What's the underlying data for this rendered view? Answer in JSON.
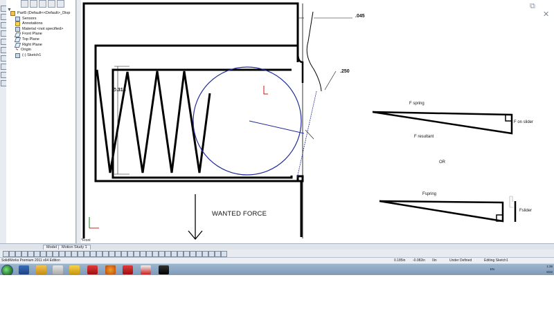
{
  "feature_manager": {
    "root": "Part5 (Default<<Default>_Disp",
    "items": [
      "Sensors",
      "Annotations",
      "Material <not specified>",
      "Front Plane",
      "Top Plane",
      "Right Plane",
      "Origin",
      "(-) Sketch1"
    ]
  },
  "graphics": {
    "dim_045": ".045",
    "dim_250": ".250",
    "dim_313": "∅.313",
    "wanted_force": "WANTED FORCE",
    "view_name": "*Front",
    "diagram1": {
      "top_label": "F spring",
      "right_label": "F on slider",
      "bottom_label": "F resultant"
    },
    "or_label": "OR",
    "diagram2": {
      "top_label": "Fspring",
      "right_label": "Fslider"
    }
  },
  "tabs": {
    "model": "Model",
    "motion": "Motion Study 1"
  },
  "status": {
    "app_edition": "SolidWorks Premium 2011 x64 Edition",
    "coord_x": "0.185in",
    "coord_y": "-0.082in",
    "coord_z": "0in",
    "state": "Under Defined",
    "editing": "Editing Sketch1"
  },
  "tray": {
    "lang": "EN",
    "time": "1:36",
    "date": "8/22"
  },
  "colors": {
    "sketch_blue": "#1f2a9a",
    "taskbar": "#8aa5c1"
  }
}
